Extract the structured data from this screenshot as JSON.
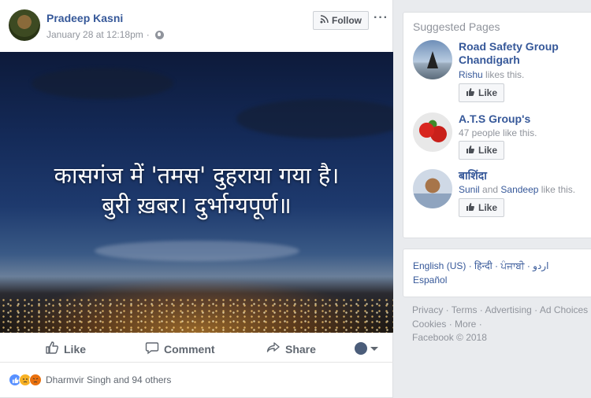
{
  "post": {
    "author": "Pradeep Kasni",
    "timestamp": "January 28 at 12:18pm",
    "separator": "·",
    "follow_label": "Follow",
    "more_label": "···",
    "photo_text_line1": "कासगंज में 'तमस' दुहराया गया है।",
    "photo_text_line2": "बुरी ख़बर। दुर्भाग्यपूर्ण॥",
    "actions": {
      "like": "Like",
      "comment": "Comment",
      "share": "Share"
    },
    "reactions_text": "Dharmvir Singh and 94 others"
  },
  "sidebar": {
    "suggested_title": "Suggested Pages",
    "pages": [
      {
        "name": "Road Safety Group Chandigarh",
        "likes_name": "Rishu",
        "likes_rest": " likes this.",
        "like_label": "Like"
      },
      {
        "name": "A.T.S Group's",
        "likes_name": "",
        "likes_rest": "47 people like this.",
        "like_label": "Like"
      },
      {
        "name": "बाशिंदा",
        "likes_name": "Sunil",
        "likes_mid": " and ",
        "likes_name2": "Sandeep",
        "likes_rest": " like this.",
        "like_label": "Like"
      }
    ],
    "languages": {
      "current": "English (US)",
      "sep": " · ",
      "hindi": "हिन्दी",
      "punjabi": "ਪੰਜਾਬੀ",
      "urdu": "اردو",
      "spanish": "Español"
    },
    "footer": {
      "line1": "Privacy · Terms · Advertising · Ad Choices",
      "line2": "Cookies · More ·",
      "line3": "Facebook © 2018"
    }
  },
  "colors": {
    "link": "#365899",
    "muted": "#90949c",
    "background": "#e9ebee"
  }
}
